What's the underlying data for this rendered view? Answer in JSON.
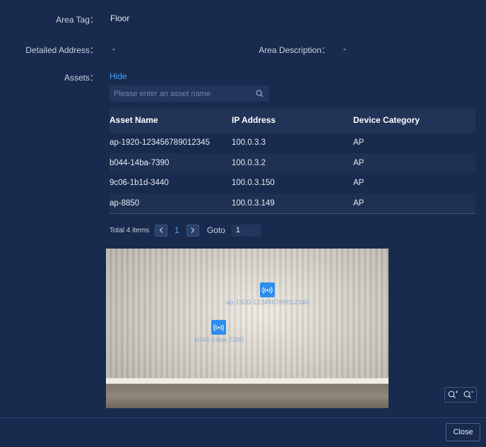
{
  "area_tag": {
    "label": "Area Tag：",
    "value": "Floor"
  },
  "detailed_address": {
    "label": "Detailed Address：",
    "value": "-"
  },
  "area_description": {
    "label": "Area Description：",
    "value": "-"
  },
  "assets": {
    "label": "Assets：",
    "toggle": "Hide"
  },
  "search": {
    "placeholder": "Please enter an asset name",
    "icon": "search-icon"
  },
  "table": {
    "columns": [
      "Asset Name",
      "IP Address",
      "Device Category"
    ],
    "rows": [
      [
        "ap-1920-123456789012345",
        "100.0.3.3",
        "AP"
      ],
      [
        "b044-14ba-7390",
        "100.0.3.2",
        "AP"
      ],
      [
        "9c06-1b1d-3440",
        "100.0.3.150",
        "AP"
      ],
      [
        "ap-8850",
        "100.0.3.149",
        "AP"
      ]
    ]
  },
  "pagination": {
    "total": "Total 4 items",
    "current_page": "1",
    "goto_label": "Goto",
    "goto_value": "1"
  },
  "map": {
    "markers": [
      {
        "label": "ap-1920-123456789012345",
        "icon": "wifi-ap-icon"
      },
      {
        "label": "b044-14ba-7390",
        "icon": "wifi-ap-icon"
      }
    ]
  },
  "zoom": {
    "in_icon": "zoom-in-icon",
    "out_icon": "zoom-out-icon"
  },
  "footer": {
    "close_label": "Close"
  },
  "colors": {
    "background": "#182a4d",
    "accent": "#4aa3ff",
    "marker": "#2a8df0"
  }
}
